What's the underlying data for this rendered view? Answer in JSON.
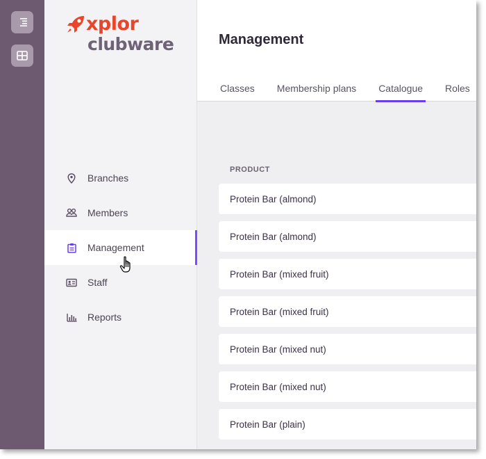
{
  "brand": {
    "wordmark": "xplor",
    "product": "clubware",
    "accent_color": "#e8452c",
    "product_color": "#6e6276"
  },
  "rail": {
    "items": [
      {
        "icon": "menu-icon"
      },
      {
        "icon": "apps-grid-icon"
      }
    ]
  },
  "sidebar": {
    "items": [
      {
        "label": "Branches",
        "icon": "map-pin-icon"
      },
      {
        "label": "Members",
        "icon": "members-icon"
      },
      {
        "label": "Management",
        "icon": "clipboard-icon",
        "active": true
      },
      {
        "label": "Staff",
        "icon": "id-card-icon"
      },
      {
        "label": "Reports",
        "icon": "bar-chart-icon"
      }
    ],
    "active_indicator_color": "#7a4bff"
  },
  "header": {
    "title": "Management",
    "tabs": [
      {
        "label": "Classes"
      },
      {
        "label": "Membership plans"
      },
      {
        "label": "Catalogue",
        "active": true
      },
      {
        "label": "Roles"
      }
    ]
  },
  "catalogue": {
    "column_header": "PRODUCT",
    "rows": [
      "Protein Bar (almond)",
      "Protein Bar (almond)",
      "Protein Bar (mixed fruit)",
      "Protein Bar (mixed fruit)",
      "Protein Bar (mixed nut)",
      "Protein Bar (mixed nut)",
      "Protein Bar (plain)"
    ]
  }
}
